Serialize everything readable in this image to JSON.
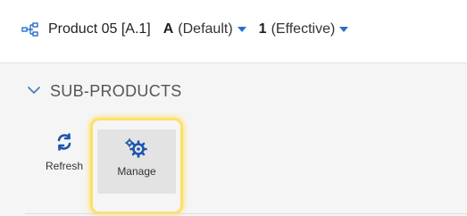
{
  "header": {
    "product_title": "Product 05 [A.1]",
    "revision": "A",
    "revision_label": "(Default)",
    "iteration": "1",
    "iteration_label": "(Effective)"
  },
  "section": {
    "title": "SUB-PRODUCTS",
    "expanded": true
  },
  "toolbar": {
    "refresh_label": "Refresh",
    "manage_label": "Manage"
  },
  "colors": {
    "accent": "#2a6fc9",
    "highlight": "#ffe066"
  },
  "icons": {
    "product": "product-structure-icon",
    "refresh": "refresh-icon",
    "manage": "manage-gears-icon",
    "collapse": "chevron-down-icon"
  }
}
